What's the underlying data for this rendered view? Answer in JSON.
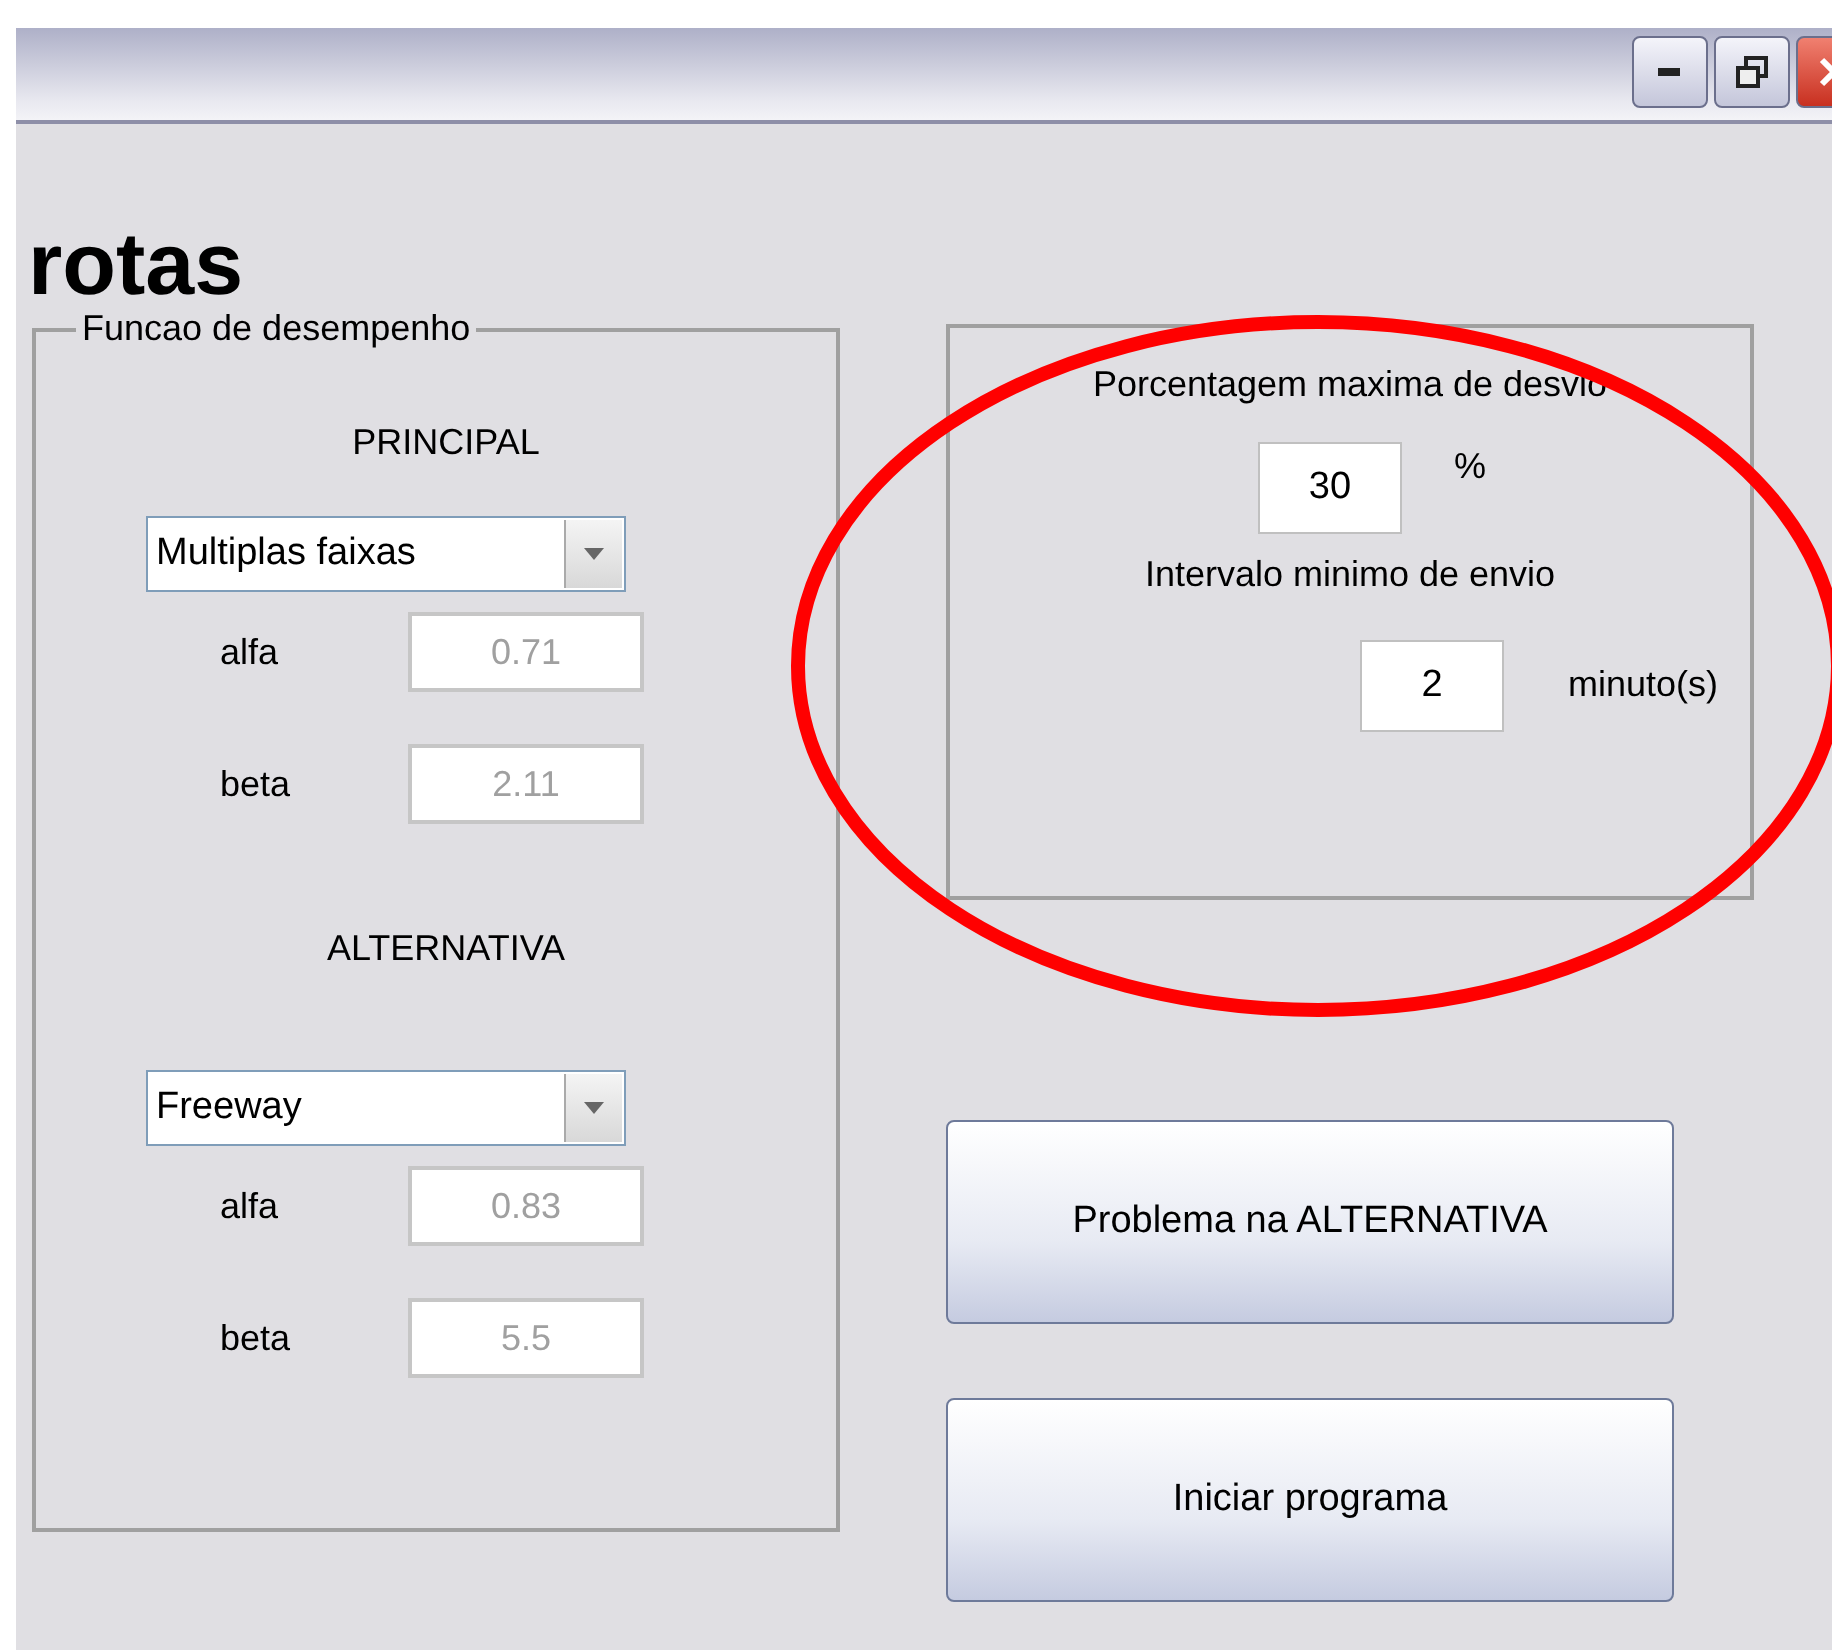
{
  "window": {
    "controls": [
      {
        "kind": "minimize"
      },
      {
        "kind": "restore"
      },
      {
        "kind": "close"
      }
    ]
  },
  "title": "rotas",
  "performance_group": {
    "legend": "Funcao de desempenho",
    "sections": [
      {
        "heading": "PRINCIPAL",
        "select": "Multiplas faixas",
        "fields": [
          {
            "label": "alfa",
            "value": "0.71",
            "disabled": true
          },
          {
            "label": "beta",
            "value": "2.11",
            "disabled": true
          }
        ]
      },
      {
        "heading": "ALTERNATIVA",
        "select": "Freeway",
        "fields": [
          {
            "label": "alfa",
            "value": "0.83",
            "disabled": true
          },
          {
            "label": "beta",
            "value": "5.5",
            "disabled": true
          }
        ]
      }
    ]
  },
  "settings": [
    {
      "label": "Porcentagem maxima de desvio",
      "value": "30",
      "unit": "%"
    },
    {
      "label": "Intervalo minimo de envio",
      "value": "2",
      "unit": "minuto(s)"
    }
  ],
  "annotation": {
    "kind": "ellipse",
    "color": "#ff0000"
  },
  "buttons": [
    "Problema na ALTERNATIVA",
    "Iniciar programa"
  ]
}
